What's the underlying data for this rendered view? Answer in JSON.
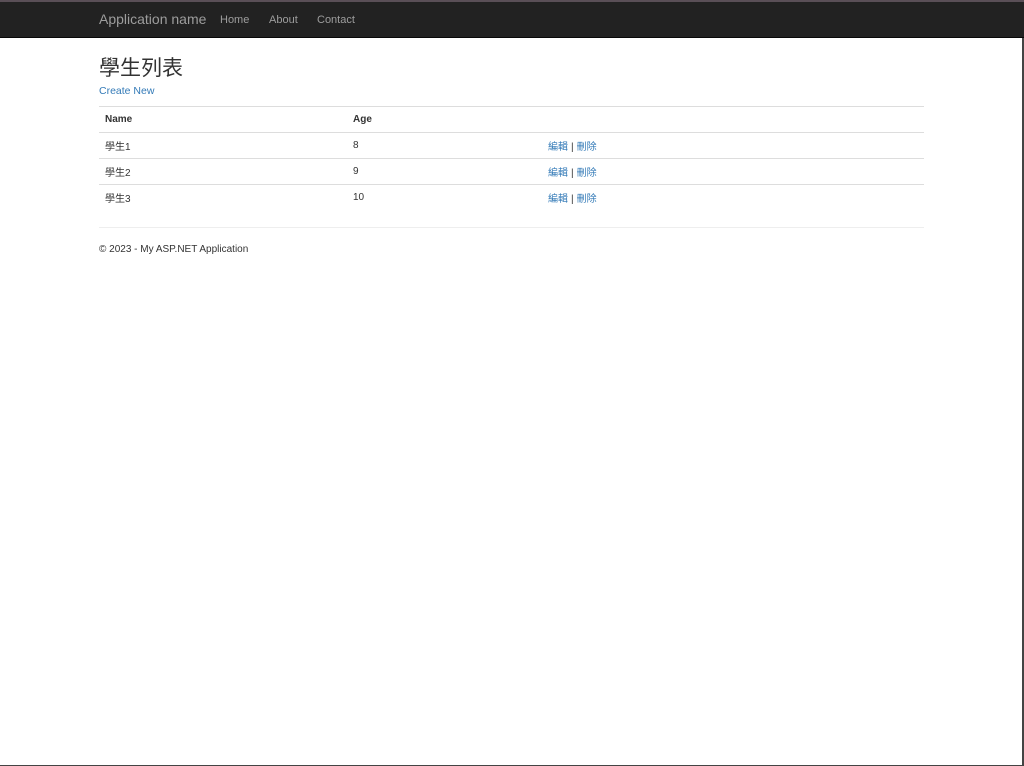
{
  "navbar": {
    "brand": "Application name",
    "links": [
      {
        "label": "Home"
      },
      {
        "label": "About"
      },
      {
        "label": "Contact"
      }
    ]
  },
  "page": {
    "title": "學生列表",
    "create_link": "Create New"
  },
  "table": {
    "headers": [
      "Name",
      "Age",
      ""
    ],
    "rows": [
      {
        "name": "學生1",
        "age": "8",
        "edit": "編輯",
        "delete": "刪除"
      },
      {
        "name": "學生2",
        "age": "9",
        "edit": "編輯",
        "delete": "刪除"
      },
      {
        "name": "學生3",
        "age": "10",
        "edit": "編輯",
        "delete": "刪除"
      }
    ],
    "separator": "|"
  },
  "footer": {
    "text": "© 2023 - My ASP.NET Application"
  },
  "colors": {
    "navbar_bg": "#222222",
    "link": "#337ab7",
    "nav_text": "#9d9d9d"
  }
}
